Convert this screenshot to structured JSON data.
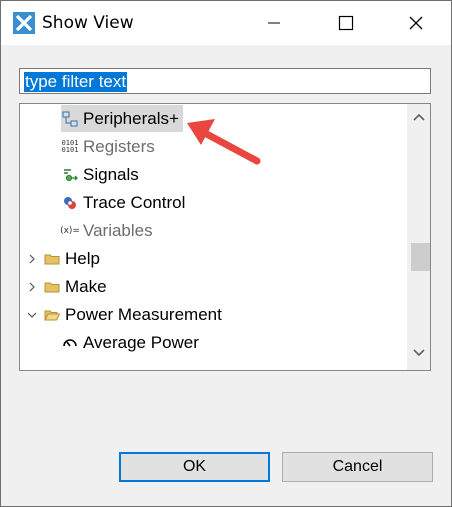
{
  "window": {
    "title": "Show View"
  },
  "filter": {
    "value": "type filter text"
  },
  "tree": {
    "items": [
      {
        "label": "Peripherals+",
        "selected": true
      },
      {
        "label": "Registers",
        "disabled": true
      },
      {
        "label": "Signals"
      },
      {
        "label": "Trace Control"
      },
      {
        "label": "Variables",
        "disabled": true
      },
      {
        "label": "Help",
        "expanded": false
      },
      {
        "label": "Make",
        "expanded": false
      },
      {
        "label": "Power Measurement",
        "expanded": true
      },
      {
        "label": "Average Power"
      }
    ],
    "icons": {
      "variables": "(x)=",
      "registers": "0101"
    }
  },
  "buttons": {
    "ok": "OK",
    "cancel": "Cancel"
  },
  "colors": {
    "accent": "#0078d7",
    "annotation_arrow": "#e8463e",
    "folder": "#e5c365"
  }
}
